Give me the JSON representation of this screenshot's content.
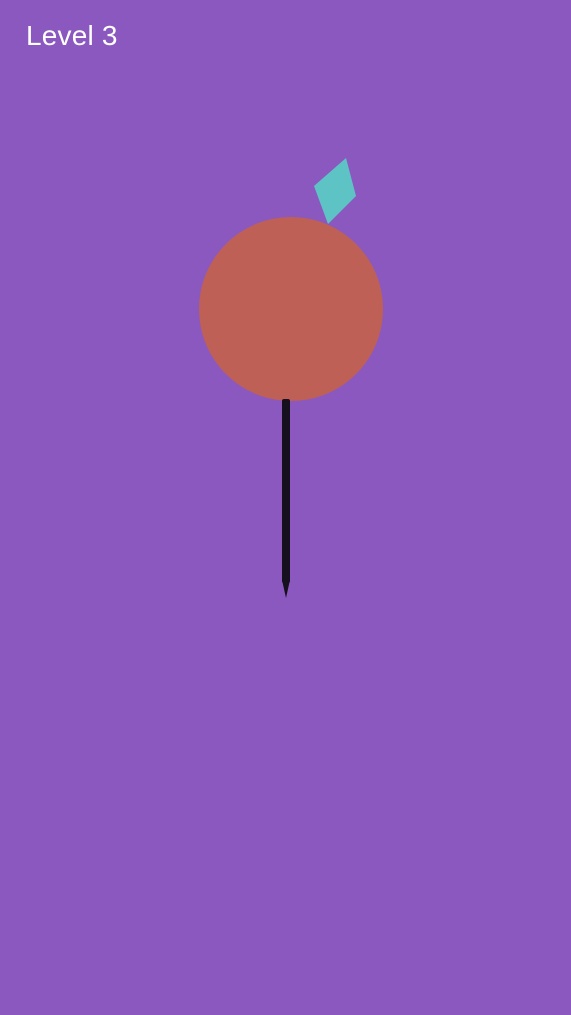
{
  "hud": {
    "level_label": "Level 3"
  },
  "colors": {
    "background": "#8b58bf",
    "target": "#bf6056",
    "gem": "#5ec3c4",
    "knife": "#16101e",
    "text": "#ffffff"
  },
  "icons": {
    "target": "target-circle-icon",
    "gem": "diamond-gem-icon",
    "knife": "knife-icon"
  }
}
